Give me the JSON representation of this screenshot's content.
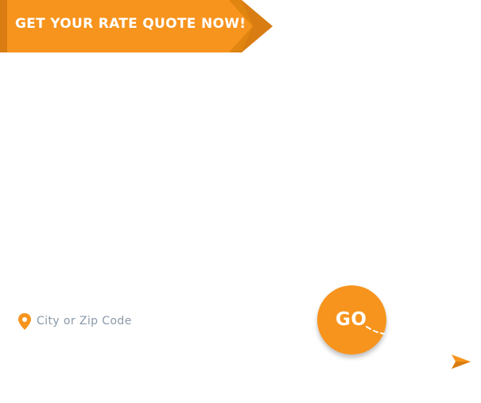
{
  "banner": {
    "text": "GET YOUR RATE QUOTE NOW!"
  },
  "location": {
    "placeholder": "City or Zip Code",
    "icon": "map-pin-icon"
  },
  "go_button": {
    "label": "GO"
  },
  "icons": {
    "plane": "paper-plane-icon"
  },
  "colors": {
    "accent": "#f7941d",
    "accent_dark": "#d97d12",
    "accent_shadow": "#c96f0c",
    "placeholder": "#8a99a8"
  }
}
